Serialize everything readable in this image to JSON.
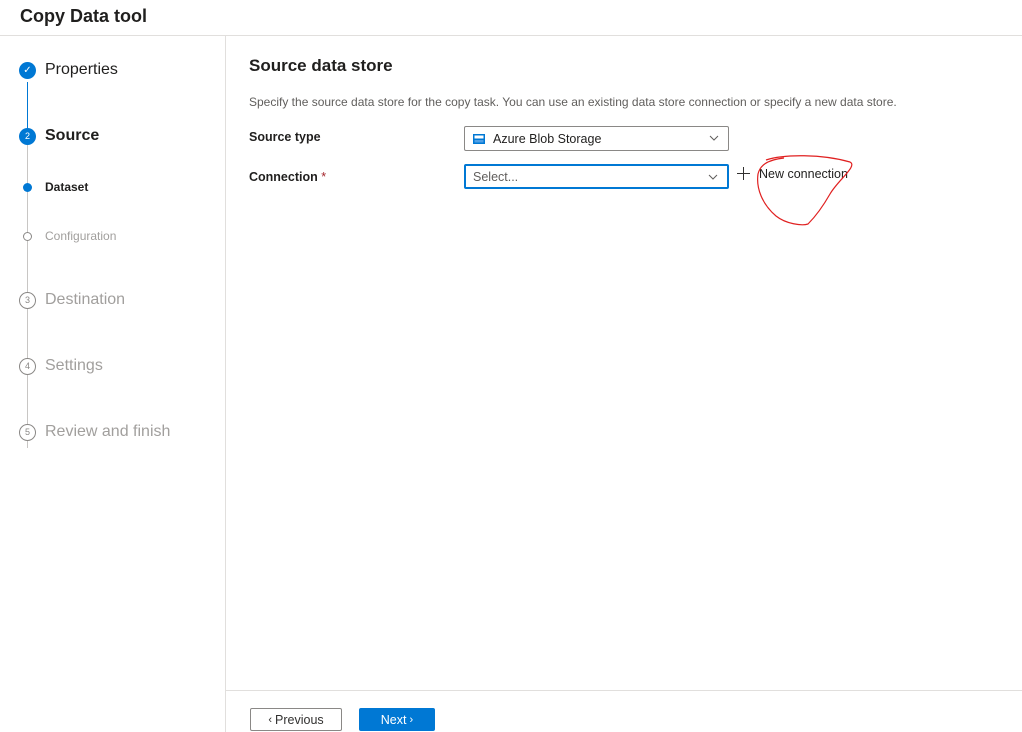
{
  "app": {
    "title": "Copy Data tool"
  },
  "steps": [
    {
      "number": "✓",
      "label": "Properties",
      "state": "done"
    },
    {
      "number": "2",
      "label": "Source",
      "state": "active"
    },
    {
      "number": "3",
      "label": "Destination",
      "state": "pending"
    },
    {
      "number": "4",
      "label": "Settings",
      "state": "pending"
    },
    {
      "number": "5",
      "label": "Review and finish",
      "state": "pending"
    }
  ],
  "substeps": [
    {
      "label": "Dataset",
      "state": "active"
    },
    {
      "label": "Configuration",
      "state": "pending"
    }
  ],
  "main": {
    "title": "Source data store",
    "description": "Specify the source data store for the copy task. You can use an existing data store connection or specify a new data store.",
    "source_type": {
      "label": "Source type",
      "value": "Azure Blob Storage",
      "icon": "azure-blob-storage-icon"
    },
    "connection": {
      "label": "Connection",
      "required_mark": "*",
      "placeholder": "Select..."
    },
    "new_connection": {
      "label": "New connection",
      "icon": "plus-icon"
    }
  },
  "footer": {
    "previous_label": "Previous",
    "next_label": "Next"
  },
  "colors": {
    "accent": "#0078d4",
    "annotation": "#e02020",
    "required": "#a4262c"
  }
}
